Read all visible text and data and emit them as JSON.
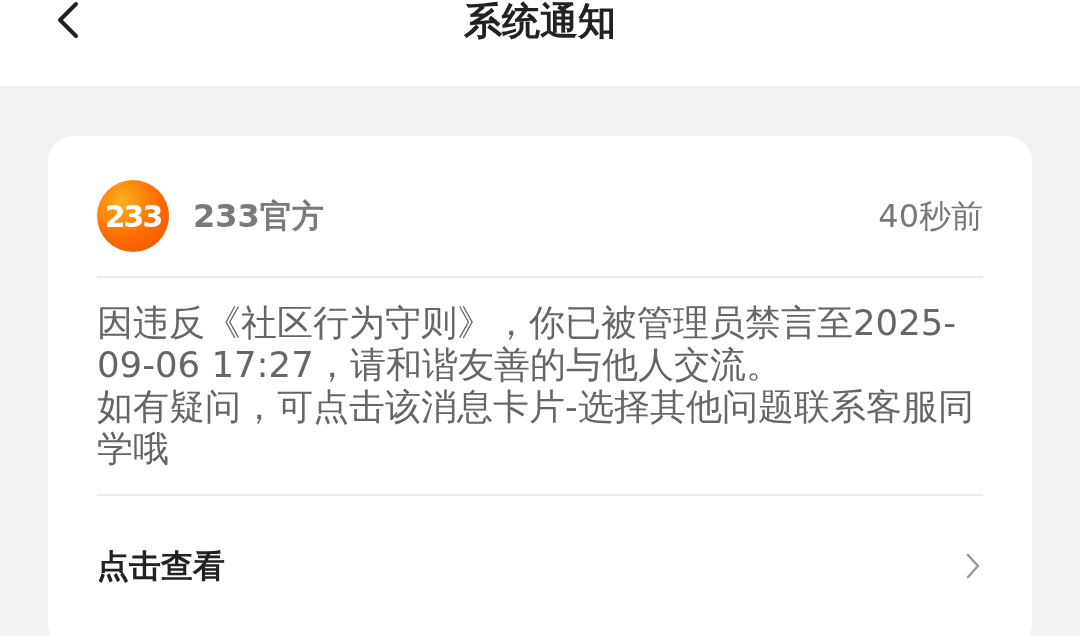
{
  "header": {
    "title": "系统通知"
  },
  "notice": {
    "logo_text": "233",
    "sender": "233官方",
    "time": "40秒前",
    "paragraphs": [
      "因违反《社区行为守则》，你已被管理员禁言至2025-09-06 17:27，请和谐友善的与他人交流。",
      "如有疑问，可点击该消息卡片-选择其他问题联系客服同学哦"
    ],
    "action": "点击查看"
  }
}
